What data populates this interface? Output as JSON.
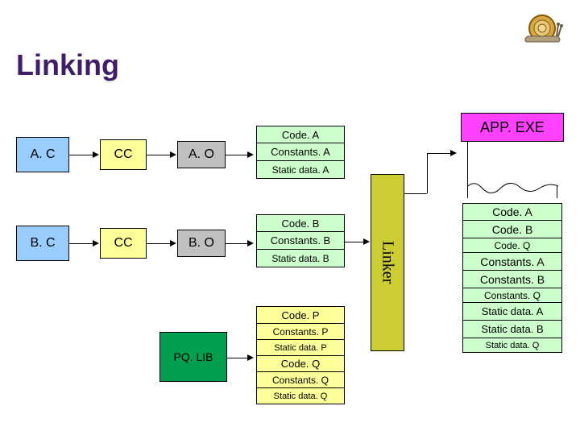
{
  "title": "Linking",
  "ac": {
    "label": "A. C"
  },
  "bc": {
    "label": "B. C"
  },
  "cc1": "CC",
  "cc2": "CC",
  "ao": "A. O",
  "bo": "B. O",
  "pqlib": "PQ. LIB",
  "aout": {
    "code": "Code. A",
    "const": "Constants. A",
    "static": "Static data. A"
  },
  "bout": {
    "code": "Code. B",
    "const": "Constants. B",
    "static": "Static data. B"
  },
  "pqout": {
    "codeP": "Code. P",
    "constP": "Constants. P",
    "staticP": "Static data. P",
    "codeQ": "Code. Q",
    "constQ": "Constants. Q",
    "staticQ": "Static data. Q"
  },
  "linker": "Linker",
  "appexe": "APP. EXE",
  "finalout": {
    "codeA": "Code. A",
    "codeB": "Code. B",
    "codeQ": "Code. Q",
    "constA": "Constants. A",
    "constB": "Constants. B",
    "constQ": "Constants. Q",
    "staticA": "Static data. A",
    "staticB": "Static data. B",
    "staticQ": "Static data. Q"
  }
}
